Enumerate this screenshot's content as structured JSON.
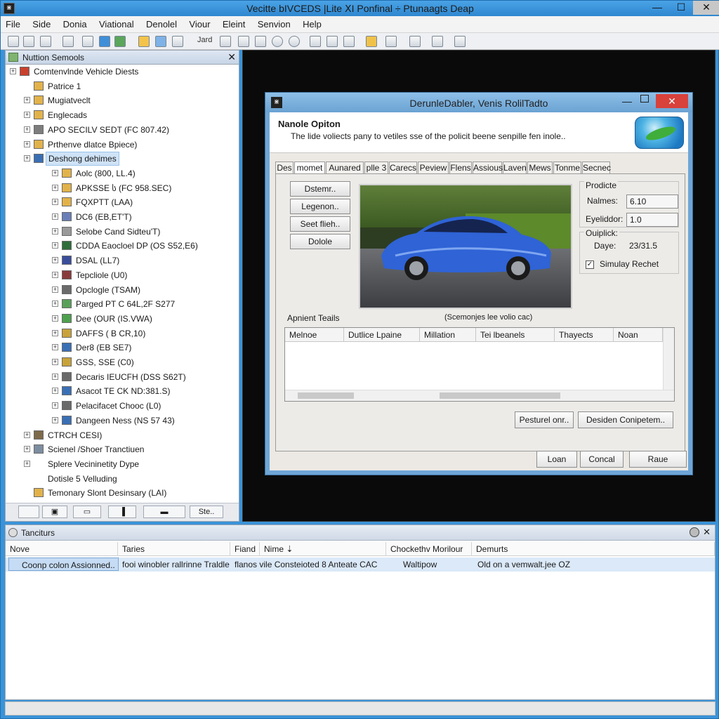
{
  "window": {
    "title": "Vecitte bIVCEDS |Lite ⅩI Ponfinal ÷ Ptunaagts Deap"
  },
  "menu": [
    "File",
    "Side",
    "Donia",
    "Viational",
    "Denolel",
    "Viour",
    "Eleint",
    "Senvion",
    "Help"
  ],
  "toolbar": {
    "text1": "Jard",
    "text2": "I"
  },
  "left_panel": {
    "title": "Nuttion Semools",
    "close": "✕",
    "tree": [
      {
        "label": "Comtenvlnde Vehicle Diests",
        "level": 0,
        "exp": "+",
        "color": "#c9402c"
      },
      {
        "label": "Patrice 1",
        "level": 1,
        "exp": "",
        "color": "#e2b24a"
      },
      {
        "label": "Mugiatveclt",
        "level": 1,
        "exp": "+",
        "color": "#e2b24a"
      },
      {
        "label": "Englecads",
        "level": 1,
        "exp": "+",
        "color": "#e2b24a"
      },
      {
        "label": "APO SECILV SEDT (FC 807.42)",
        "level": 1,
        "exp": "+",
        "color": "#7d7d7d"
      },
      {
        "label": "Prthenve dlatce Bpiece)",
        "level": 1,
        "exp": "+",
        "color": "#e2b24a"
      },
      {
        "label": "Deshong dehimes",
        "level": 1,
        "exp": "+",
        "color": "#3a6fb5",
        "selected": true
      },
      {
        "label": "Aolc (800, LL.4)",
        "level": 2,
        "exp": "+",
        "color": "#e2b24a"
      },
      {
        "label": "APKSSE ს (FC 958.SEC)",
        "level": 2,
        "exp": "+",
        "color": "#e2b24a"
      },
      {
        "label": "FQXPTT (LAA)",
        "level": 2,
        "exp": "+",
        "color": "#e2b24a"
      },
      {
        "label": "DC6 (EB,ET'T)",
        "level": 2,
        "exp": "+",
        "color": "#6a7fb8"
      },
      {
        "label": "Selobe Cand Sidteu'T)",
        "level": 2,
        "exp": "+",
        "color": "#9a9a9a"
      },
      {
        "label": "CDDA Eaocloel DP (OS S52,E6)",
        "level": 2,
        "exp": "+",
        "color": "#2f6d3a"
      },
      {
        "label": "DSAL (LL7)",
        "level": 2,
        "exp": "+",
        "color": "#3a4d9b"
      },
      {
        "label": "Tepcliole (U0)",
        "level": 2,
        "exp": "+",
        "color": "#8a3b3b"
      },
      {
        "label": "Opclogle (TSAM)",
        "level": 2,
        "exp": "+",
        "color": "#6a6a6a"
      },
      {
        "label": "Parged PT C 64L,2F S277",
        "level": 2,
        "exp": "+",
        "color": "#5aa05a"
      },
      {
        "label": "Dee (OUR (IS.VWA)",
        "level": 2,
        "exp": "+",
        "color": "#4ea04e"
      },
      {
        "label": "DAFFS ( B CR,10)",
        "level": 2,
        "exp": "+",
        "color": "#c8a23a"
      },
      {
        "label": "Der8 (EB SE7)",
        "level": 2,
        "exp": "+",
        "color": "#3a6fb5"
      },
      {
        "label": "GSS, SSE (C0)",
        "level": 2,
        "exp": "+",
        "color": "#c8a23a"
      },
      {
        "label": "Decaris IEUCFH (DSS S62T)",
        "level": 2,
        "exp": "+",
        "color": "#6a6a6a"
      },
      {
        "label": "Asacot TE CK ND:381.S)",
        "level": 2,
        "exp": "+",
        "color": "#3a6fb5"
      },
      {
        "label": "Pelacifacet Chooc (L0)",
        "level": 2,
        "exp": "+",
        "color": "#6a6a6a"
      },
      {
        "label": "Dangeen Ness (NS 57 43)",
        "level": 2,
        "exp": "+",
        "color": "#3a6fb5"
      },
      {
        "label": "CTRCH CESI)",
        "level": 1,
        "exp": "+",
        "color": "#7d6a4a"
      },
      {
        "label": "Scienel /Shoer Tranctiuen",
        "level": 1,
        "exp": "+",
        "color": "#7d8da0"
      },
      {
        "label": "Splere Vecininetity Dype",
        "level": 1,
        "exp": "+",
        "color": ""
      },
      {
        "label": "Dotisle 5 Velluding",
        "level": 1,
        "exp": "",
        "color": ""
      },
      {
        "label": "Temonary Slont Desinsary (LAI)",
        "level": 1,
        "exp": "",
        "color": "#e2b24a"
      }
    ],
    "footer_button": "Ste.."
  },
  "dialog": {
    "title": "DerunleDabler, Venis RolilTadto",
    "close": "✕",
    "minimize": "—",
    "header_title": "Nanole Opiton",
    "header_desc": "The lide voliects pany to vetiles sse of the policit beene senpille fen inole..",
    "tabs": [
      "Des",
      "momet",
      "Aunared",
      "plle 3",
      "Carecs",
      "Peview",
      "Flens",
      "Assious",
      "Laven",
      "Mews",
      "Tonme",
      "Secnec"
    ],
    "active_tab": 1,
    "left_buttons": [
      "Dstemr..",
      "Legenon..",
      "Seet flieh..",
      "Dolole"
    ],
    "group1": {
      "title": "Prodicte",
      "name_label": "Nalmes:",
      "name_value": "6.10",
      "eyelidor_label": "Eyeliddor:",
      "eyelidor_value": "1.0"
    },
    "group2": {
      "title": "Ouiplick:",
      "date_label": "Daye:",
      "date_value": "23/31.5",
      "check_label": "Simulay Rechet",
      "check_mark": "✓"
    },
    "grid_caption_left": "Apnient Teails",
    "grid_caption_right": "(Scemonjes lee volio cac)",
    "grid_columns": [
      "Melnoe",
      "Dutlice Lpaine",
      "Millation",
      "Tei lbeanels",
      "Thayects",
      "Noan"
    ],
    "bottom_buttons": {
      "b1": "Pesturel onr..",
      "b2": "Desiden Conipetem.."
    },
    "footer_buttons": {
      "ok": "Loan",
      "cancel": "Concal",
      "other": "Raue"
    }
  },
  "bottom_panel": {
    "title": "Tanciturs",
    "close": "✕",
    "columns": [
      "Nove",
      "Taries",
      "Fiand",
      "Nime ⇣",
      "Chockethv Morilour",
      "Demurts"
    ],
    "row": {
      "c1": "Coonp colon Assionned..",
      "c2": "fooi winobler rallrinne Traldle",
      "c3": "flanos vile Consteioted 8 Anteate CAC",
      "c4": "Waltipow",
      "c5": "Old on a vemwalt.jee OZ"
    }
  }
}
